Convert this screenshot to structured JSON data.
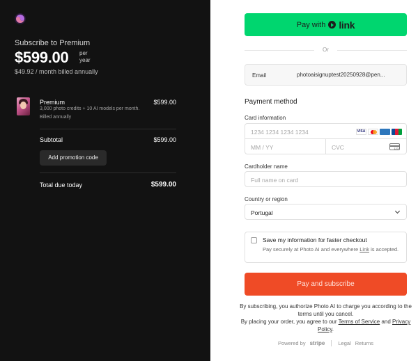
{
  "summary": {
    "subscribe_title": "Subscribe to Premium",
    "price": "$599.00",
    "per": "per",
    "year": "year",
    "monthly": "$49.92 / month billed annually",
    "item": {
      "name": "Premium",
      "price": "$599.00",
      "description": "3,000 photo credits + 10 AI models per month.",
      "billed": "Billed annually"
    },
    "subtotal_label": "Subtotal",
    "subtotal_value": "$599.00",
    "promo_label": "Add promotion code",
    "total_label": "Total due today",
    "total_value": "$599.00"
  },
  "checkout": {
    "link_button": {
      "prefix": "Pay with",
      "brand": "link"
    },
    "or": "Or",
    "email_label": "Email",
    "email_value": "photoaisignuptest20250928@pen...",
    "payment_method_title": "Payment method",
    "card_info_label": "Card information",
    "card_number_placeholder": "1234 1234 1234 1234",
    "expiry_placeholder": "MM / YY",
    "cvc_placeholder": "CVC",
    "card_brands": [
      "VISA",
      "Mastercard",
      "AMEX",
      "JCB"
    ],
    "cardholder_label": "Cardholder name",
    "cardholder_placeholder": "Full name on card",
    "country_label": "Country or region",
    "country_value": "Portugal",
    "save_title": "Save my information for faster checkout",
    "save_desc_prefix": "Pay securely at Photo AI and everywhere ",
    "save_desc_link": "Link",
    "save_desc_suffix": " is accepted.",
    "pay_button": "Pay and subscribe",
    "terms_line1": "By subscribing, you authorize Photo AI to charge you according to the terms until you cancel.",
    "terms_line2_prefix": "By placing your order, you agree to our ",
    "terms_of_service": "Terms of Service",
    "terms_and": " and ",
    "privacy_policy": "Privacy Policy",
    "terms_end": ".",
    "powered_by": "Powered by",
    "stripe": "stripe",
    "legal": "Legal",
    "returns": "Returns"
  },
  "colors": {
    "left_bg": "#121212",
    "link_green": "#00d66f",
    "pay_button": "#ef4b26"
  }
}
